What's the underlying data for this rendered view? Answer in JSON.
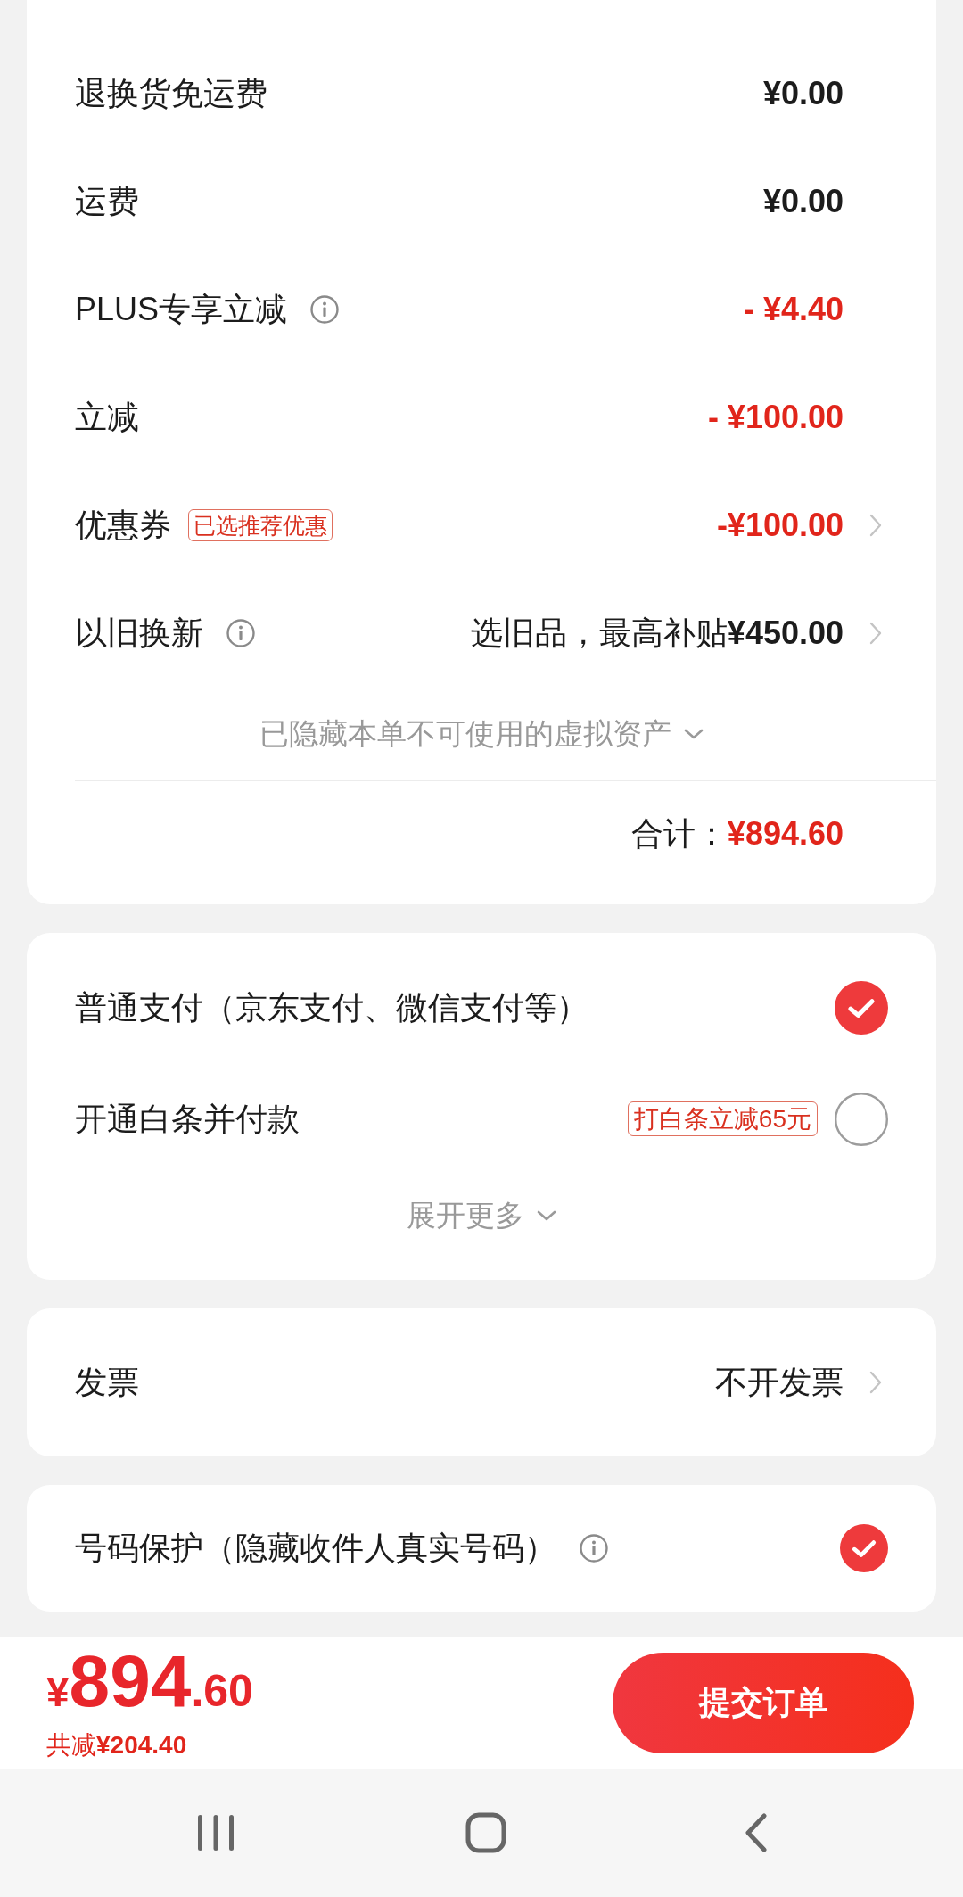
{
  "price_rows": [
    {
      "label": "退换货免运费",
      "info": false,
      "kind": "amount",
      "value": "¥0.00",
      "link": false
    },
    {
      "label": "运费",
      "info": false,
      "kind": "amount",
      "value": "¥0.00",
      "link": false
    },
    {
      "label": "PLUS专享立减",
      "info": true,
      "kind": "discount",
      "value": "- ¥4.40",
      "link": false
    },
    {
      "label": "立减",
      "info": false,
      "kind": "discount",
      "value": "- ¥100.00",
      "link": false
    },
    {
      "label": "优惠券",
      "tag": "已选推荐优惠",
      "info": false,
      "kind": "discount",
      "value": "-¥100.00",
      "link": true
    },
    {
      "label": "以旧换新",
      "info": true,
      "kind": "offer",
      "value": "选旧品，最高补贴**¥450.00**",
      "link": true
    }
  ],
  "hidden_assets_toggle": {
    "label": "已隐藏本单不可使用的虚拟资产",
    "expanded": false
  },
  "total": {
    "label": "合计：",
    "value": "¥894.60"
  },
  "payment_methods": [
    {
      "label": "普通支付（京东支付、微信支付等）",
      "selected": true
    },
    {
      "label": "开通白条并付款",
      "tag": "打白条立减65元",
      "selected": false
    }
  ],
  "payment_expand": {
    "label": "展开更多",
    "expanded": false
  },
  "invoice": {
    "label": "发票",
    "value": "不开发票"
  },
  "number_protection": {
    "label": "号码保护（隐藏收件人真实号码）",
    "info": true,
    "checked": true
  },
  "bottom_bar": {
    "currency": "¥",
    "amount_integer": "894",
    "amount_decimal": ".60",
    "savings": "共减**¥204.40**",
    "submit_button": "提交订单"
  }
}
